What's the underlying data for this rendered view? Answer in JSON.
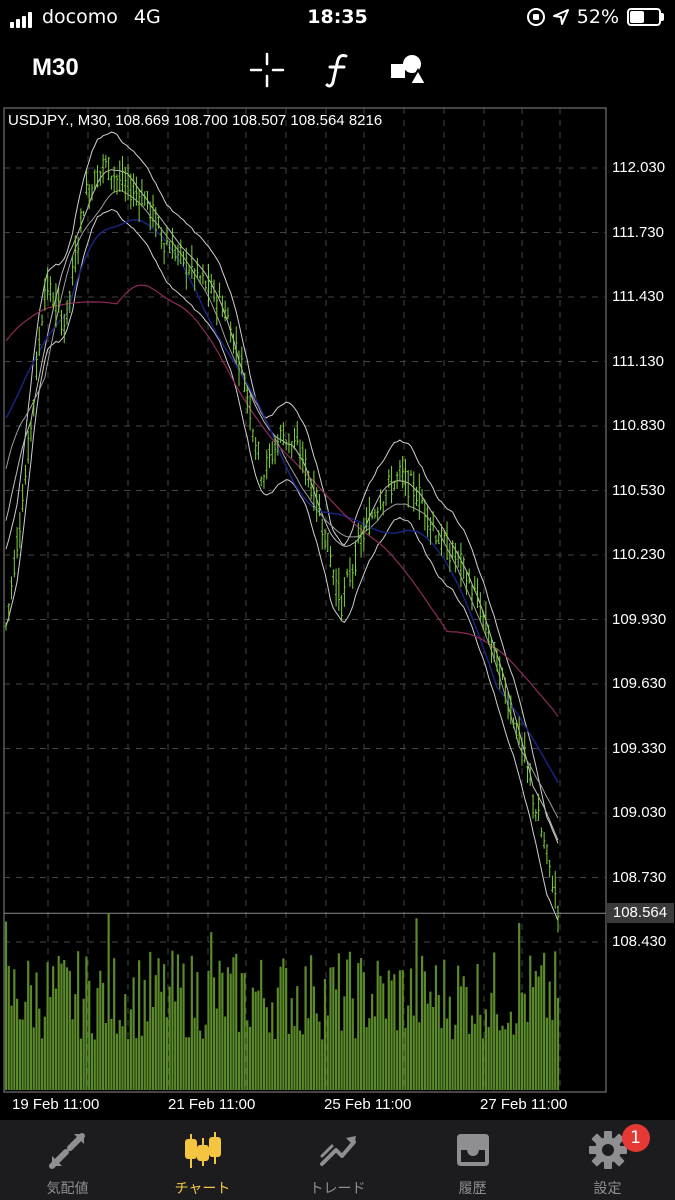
{
  "status": {
    "carrier": "docomo",
    "network": "4G",
    "time": "18:35",
    "battery": "52%",
    "battery_level": 0.52
  },
  "toolbar": {
    "timeframe": "M30",
    "crosshair_icon": "crosshair-icon",
    "indicator_icon": "function-icon",
    "objects_icon": "shapes-icon"
  },
  "chart": {
    "header": "USDJPY., M30, 108.669 108.700 108.507 108.564 8216",
    "current_price": "108.564",
    "price_labels": [
      "112.030",
      "111.730",
      "111.430",
      "111.130",
      "110.830",
      "110.530",
      "110.230",
      "109.930",
      "109.630",
      "109.330",
      "109.030",
      "108.730",
      "108.430"
    ],
    "date_labels": [
      "19 Feb 11:00",
      "21 Feb 11:00",
      "25 Feb 11:00",
      "27 Feb 11:00"
    ],
    "colors": {
      "bull": "#7fd13b",
      "volume": "#5a8a2a",
      "grid": "#444444",
      "ma_blue": "#1a237e",
      "ma_purple": "#8e2a5a"
    }
  },
  "chart_data": {
    "type": "line",
    "title": "USDJPY., M30",
    "symbol": "USDJPY.",
    "timeframe": "M30",
    "ohlc": {
      "open": 108.669,
      "high": 108.7,
      "low": 108.507,
      "close": 108.564,
      "volume": 8216
    },
    "ylim": [
      108.43,
      112.15
    ],
    "x_ticks": [
      "19 Feb 11:00",
      "21 Feb 11:00",
      "25 Feb 11:00",
      "27 Feb 11:00"
    ],
    "y_ticks": [
      112.03,
      111.73,
      111.43,
      111.13,
      110.83,
      110.53,
      110.23,
      109.93,
      109.63,
      109.33,
      109.03,
      108.73,
      108.43
    ],
    "series": [
      {
        "values": [
          109.9,
          110.6,
          111.5,
          111.3,
          111.9,
          112.05,
          111.95,
          111.9,
          111.7,
          111.6,
          111.5,
          111.4,
          111.1,
          110.6,
          110.8,
          110.7,
          110.4,
          110.0,
          110.3,
          110.5,
          110.6,
          110.5,
          110.3,
          110.2,
          110.0,
          109.7,
          109.4,
          109.0,
          108.6
        ]
      }
    ],
    "current": 108.564,
    "grid": true
  },
  "tabs": [
    {
      "label": "気配値",
      "icon": "quotes-icon"
    },
    {
      "label": "チャート",
      "icon": "chart-icon"
    },
    {
      "label": "トレード",
      "icon": "trade-icon"
    },
    {
      "label": "履歴",
      "icon": "history-icon"
    },
    {
      "label": "設定",
      "icon": "settings-icon",
      "badge": "1"
    }
  ]
}
